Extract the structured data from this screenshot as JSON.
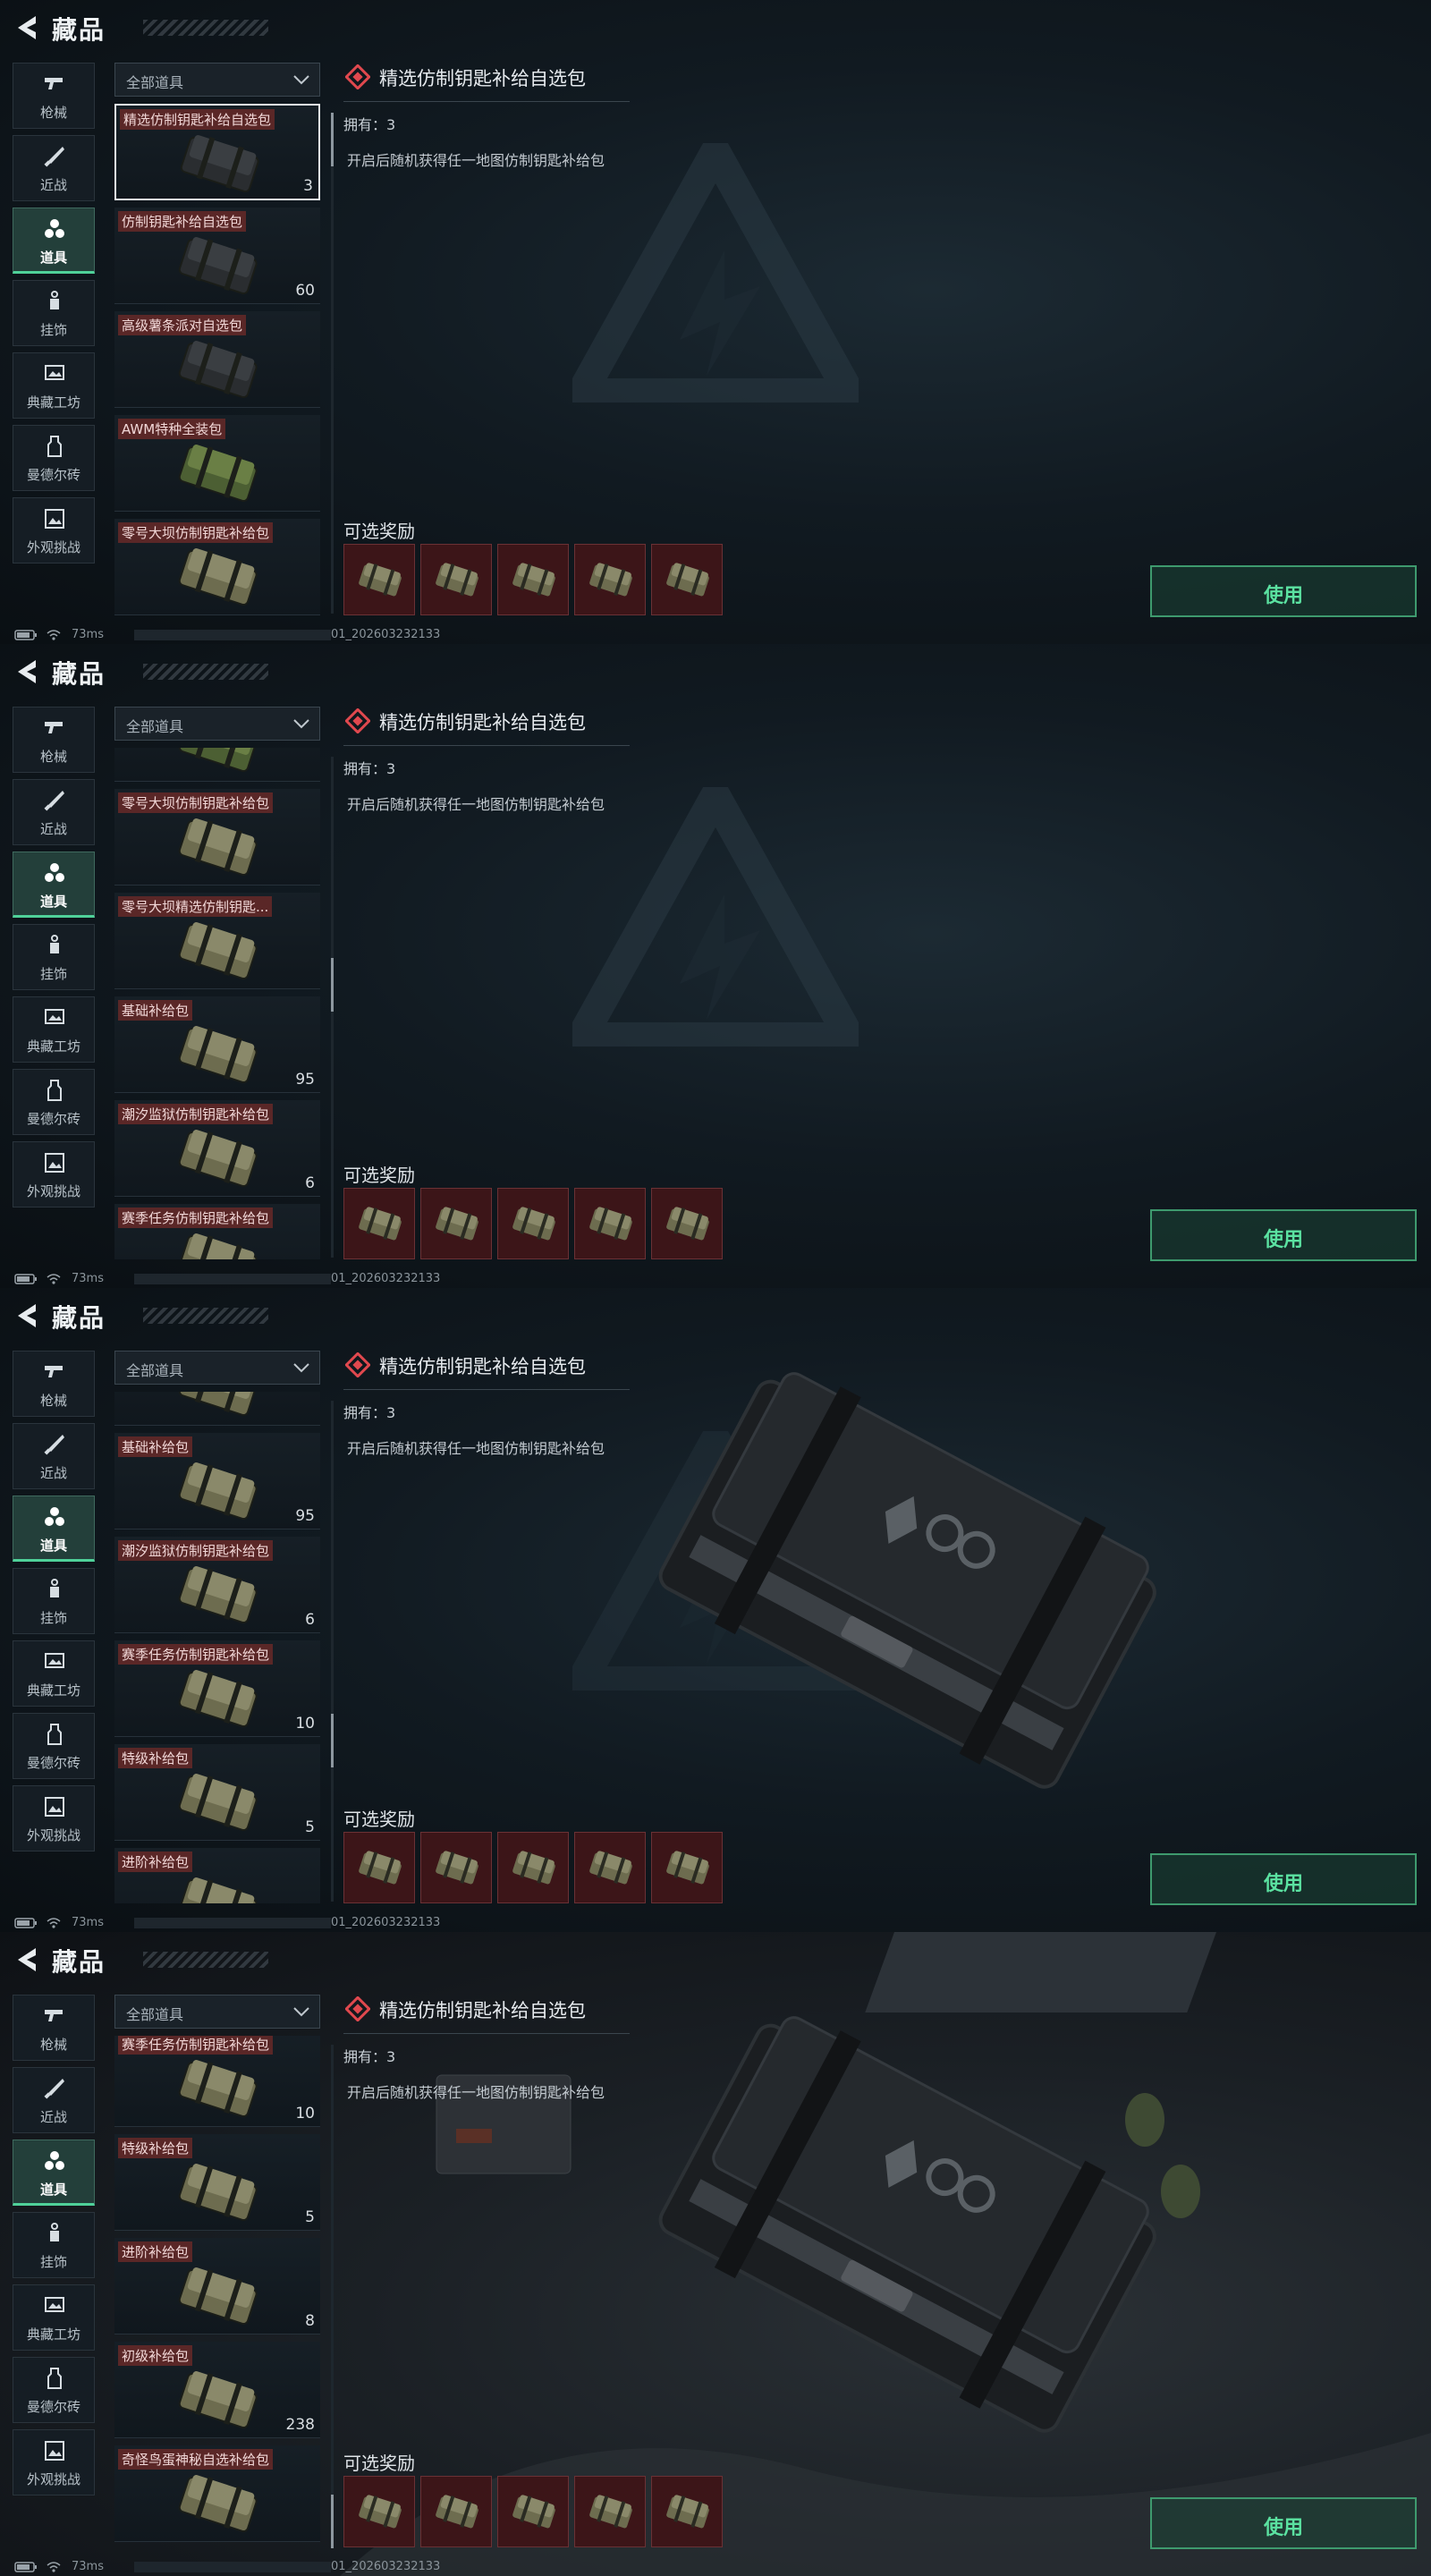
{
  "header": {
    "title": "藏品"
  },
  "categories": [
    {
      "label": "枪械",
      "icon": "gun-icon"
    },
    {
      "label": "近战",
      "icon": "knife-icon"
    },
    {
      "label": "道具",
      "icon": "items-icon"
    },
    {
      "label": "挂饰",
      "icon": "charm-icon"
    },
    {
      "label": "典藏工坊",
      "icon": "workshop-icon"
    },
    {
      "label": "曼德尔砖",
      "icon": "brick-icon"
    },
    {
      "label": "外观挑战",
      "icon": "challenge-icon"
    }
  ],
  "active_category": "道具",
  "filter": {
    "label": "全部道具"
  },
  "items": [
    {
      "name": "精选仿制钥匙补给自选包",
      "count": "3",
      "selected": true
    },
    {
      "name": "仿制钥匙补给自选包",
      "count": "60"
    },
    {
      "name": "高级薯条派对自选包",
      "count": ""
    },
    {
      "name": "AWM特种全装包",
      "count": ""
    },
    {
      "name": "零号大坝仿制钥匙补给包",
      "count": ""
    },
    {
      "name": "零号大坝精选仿制钥匙...",
      "count": ""
    },
    {
      "name": "基础补给包",
      "count": "95"
    },
    {
      "name": "潮汐监狱仿制钥匙补给包",
      "count": "6"
    },
    {
      "name": "赛季任务仿制钥匙补给包",
      "count": "10"
    },
    {
      "name": "特级补给包",
      "count": "5"
    },
    {
      "name": "进阶补给包",
      "count": "8"
    },
    {
      "name": "初级补给包",
      "count": "238"
    },
    {
      "name": "奇怪鸟蛋神秘自选补给包",
      "count": ""
    }
  ],
  "detail": {
    "title": "精选仿制钥匙补给自选包",
    "owned": "拥有：3",
    "description": "开启后随机获得任一地图仿制钥匙补给包",
    "rewards_title": "可选奖励",
    "reward_count": 5,
    "use_label": "使用"
  },
  "status": {
    "ping": "73ms",
    "uid_suffix": "01_202603232133"
  },
  "colors": {
    "accent": "#4fd199",
    "use_button": "#5be2a1",
    "item_tag": "#5a2727",
    "reward_bg": "#3c1518"
  },
  "frames": [
    {
      "scroll_offset": 0,
      "show_case": false,
      "scene": false
    },
    {
      "scroll_offset": 3.6,
      "show_case": false,
      "scene": false
    },
    {
      "scroll_offset": 5.6,
      "show_case": true,
      "scene": false
    },
    {
      "scroll_offset": 8.05,
      "show_case": true,
      "scene": true
    }
  ]
}
